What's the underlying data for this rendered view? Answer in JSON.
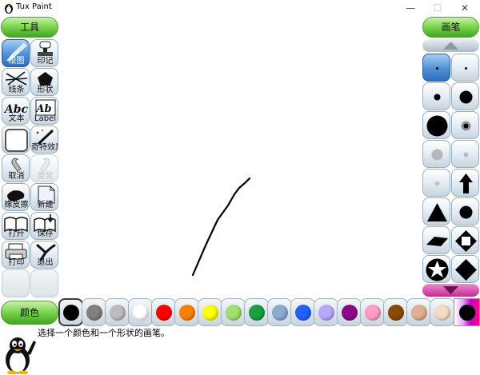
{
  "window": {
    "title": "Tux Paint",
    "min": "—",
    "max": "☐",
    "close": "✕"
  },
  "tools_header": "工具",
  "brush_header": "画笔",
  "color_header": "颜色",
  "tools": [
    {
      "label": "绘图",
      "icon": "paintbrush-icon",
      "selected": true
    },
    {
      "label": "印记",
      "icon": "stamp-icon"
    },
    {
      "label": "线条",
      "icon": "lines-icon"
    },
    {
      "label": "形状",
      "icon": "pentagon-icon"
    },
    {
      "label": "文本",
      "icon": "text-icon",
      "glyph": "Abc"
    },
    {
      "label": "Label",
      "icon": "label-icon",
      "glyph": "Ab"
    },
    {
      "label": "",
      "icon": "blank-icon"
    },
    {
      "label": "奇特效果",
      "icon": "magic-wand-icon"
    },
    {
      "label": "取消",
      "icon": "undo-icon"
    },
    {
      "label": "重复",
      "icon": "redo-icon",
      "disabled": true
    },
    {
      "label": "橡皮擦",
      "icon": "eraser-icon"
    },
    {
      "label": "新建",
      "icon": "new-page-icon"
    },
    {
      "label": "打开",
      "icon": "open-book-icon"
    },
    {
      "label": "保存",
      "icon": "save-icon"
    },
    {
      "label": "打印",
      "icon": "printer-icon"
    },
    {
      "label": "退出",
      "icon": "quit-icon"
    }
  ],
  "brushes": [
    "tiny-dot",
    "tiny-dot",
    "small-dot",
    "medium-dot",
    "large-dot",
    "fuzzy-dot",
    "blur-dot",
    "faint-dot",
    "faint-small-dot",
    "arrow-up",
    "triangle",
    "circle",
    "diamond-flat",
    "square-diamond",
    "star",
    "diamond"
  ],
  "colors": [
    {
      "name": "black",
      "hex": "#000000",
      "selected": true
    },
    {
      "name": "gray",
      "hex": "#808080"
    },
    {
      "name": "silver",
      "hex": "#bdbdbd"
    },
    {
      "name": "white",
      "hex": "#ffffff"
    },
    {
      "name": "red",
      "hex": "#ff0000"
    },
    {
      "name": "orange",
      "hex": "#ff7f00"
    },
    {
      "name": "yellow",
      "hex": "#ffff00"
    },
    {
      "name": "light-green",
      "hex": "#a0e070"
    },
    {
      "name": "green",
      "hex": "#1aa040"
    },
    {
      "name": "steel-blue",
      "hex": "#8aaad0"
    },
    {
      "name": "blue",
      "hex": "#2060ff"
    },
    {
      "name": "lavender",
      "hex": "#b8a8ff"
    },
    {
      "name": "purple",
      "hex": "#8a0a8a"
    },
    {
      "name": "pink",
      "hex": "#ff9ec8"
    },
    {
      "name": "brown",
      "hex": "#8a4a00"
    },
    {
      "name": "tan",
      "hex": "#e0b090"
    },
    {
      "name": "skin",
      "hex": "#f5dcc8"
    }
  ],
  "instruction": "选择一个颜色和一个形状的画笔。"
}
